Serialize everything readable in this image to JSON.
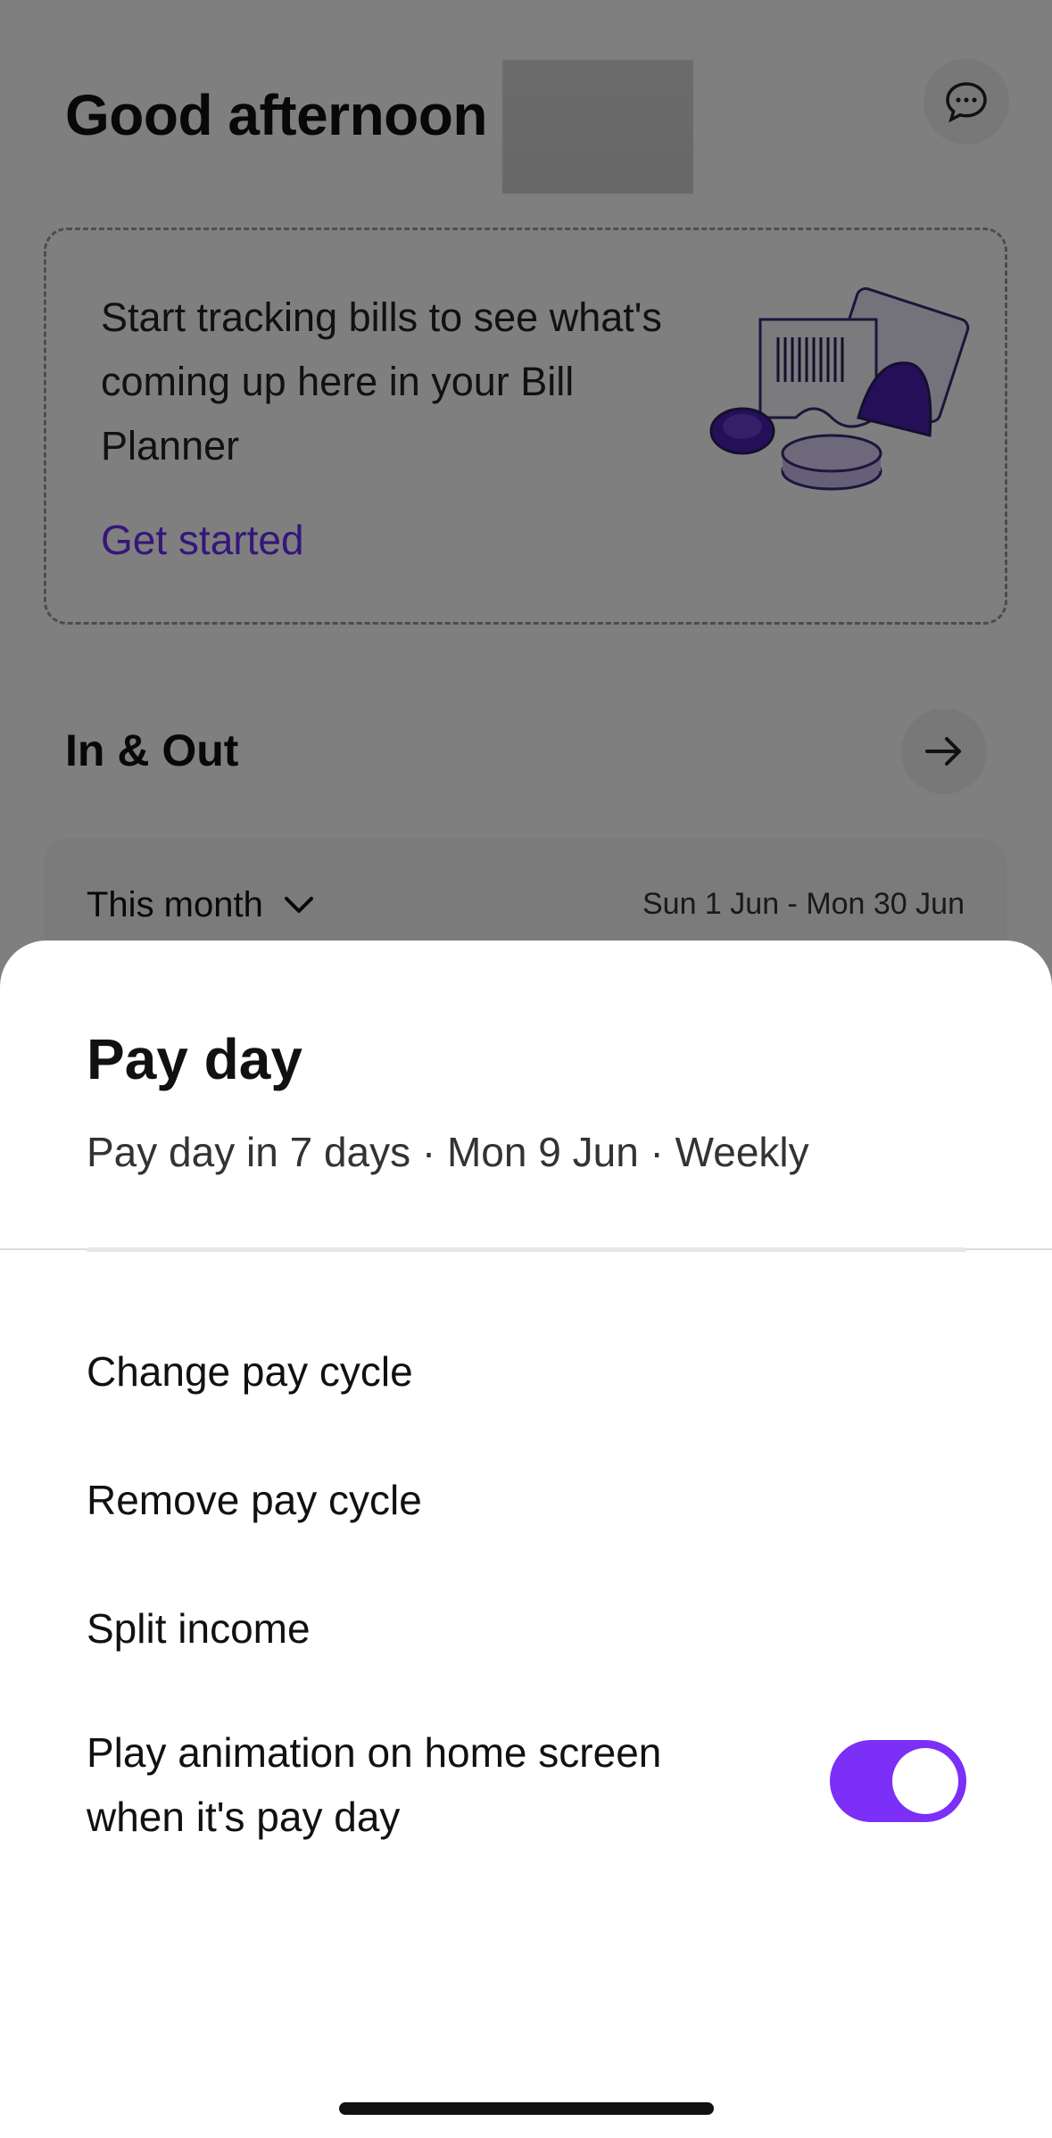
{
  "background": {
    "greeting": "Good afternoon",
    "bill_card": {
      "text": "Start tracking bills to see what's coming up here in your Bill Planner",
      "link": "Get started"
    },
    "in_out": {
      "title": "In & Out",
      "period_selector": "This month",
      "date_range": "Sun 1 Jun - Mon 30 Jun"
    }
  },
  "sheet": {
    "title": "Pay day",
    "subtitle": "Pay day in 7 days · Mon 9 Jun · Weekly",
    "options": [
      {
        "label": "Change pay cycle"
      },
      {
        "label": "Remove pay cycle"
      },
      {
        "label": "Split income"
      }
    ],
    "animation_toggle": {
      "label": "Play animation on home screen when it's pay day",
      "enabled": true
    }
  },
  "colors": {
    "accent": "#7b2ff7",
    "overlay": "rgba(0,0,0,0.5)"
  },
  "icons": {
    "chat": "chat-bubble-icon",
    "arrow": "arrow-right-icon",
    "chevron": "chevron-down-icon"
  }
}
